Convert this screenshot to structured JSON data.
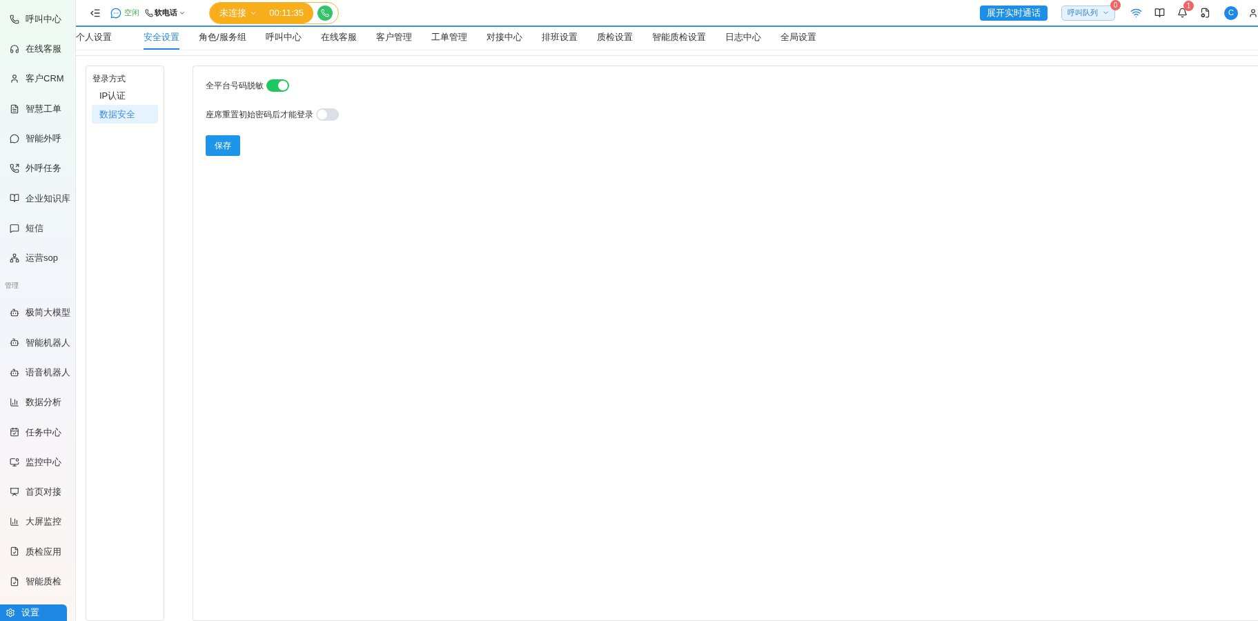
{
  "sidebar": {
    "items": [
      {
        "kind": "item",
        "label": "呼叫中心",
        "selected": false
      },
      {
        "kind": "item",
        "label": "在线客服",
        "selected": false
      },
      {
        "kind": "item",
        "label": "客户CRM",
        "selected": false
      },
      {
        "kind": "item",
        "label": "智慧工单",
        "selected": false
      },
      {
        "kind": "item",
        "label": "智能外呼",
        "selected": false
      },
      {
        "kind": "item",
        "label": "外呼任务",
        "selected": false
      },
      {
        "kind": "item",
        "label": "企业知识库",
        "selected": false
      },
      {
        "kind": "item",
        "label": "短信",
        "selected": false
      },
      {
        "kind": "item",
        "label": "运营sop",
        "selected": false
      },
      {
        "kind": "heading",
        "label": "管理"
      },
      {
        "kind": "item",
        "label": "极简大模型",
        "selected": false
      },
      {
        "kind": "item",
        "label": "智能机器人",
        "selected": false
      },
      {
        "kind": "item",
        "label": "语音机器人",
        "selected": false
      },
      {
        "kind": "item",
        "label": "数据分析",
        "selected": false
      },
      {
        "kind": "item",
        "label": "任务中心",
        "selected": false
      },
      {
        "kind": "item",
        "label": "监控中心",
        "selected": false
      },
      {
        "kind": "item",
        "label": "首页对接",
        "selected": false
      },
      {
        "kind": "item",
        "label": "大屏监控",
        "selected": false
      },
      {
        "kind": "item",
        "label": "质检应用",
        "selected": false
      },
      {
        "kind": "item",
        "label": "智能质检",
        "selected": false
      },
      {
        "kind": "item",
        "label": "设置",
        "selected": true
      }
    ]
  },
  "topbar": {
    "status": "空闲",
    "phone_mode": "软电话",
    "call": {
      "state": "未连接",
      "timer": "00:11:35"
    },
    "live_button": "展开实时通话",
    "queue": {
      "label": "呼叫队列",
      "badge": "0"
    },
    "notifications_badge": "1",
    "avatar": "C"
  },
  "tabs": [
    {
      "label": "个人设置",
      "selected": false
    },
    {
      "label": "安全设置",
      "selected": true
    },
    {
      "label": "角色/服务组",
      "selected": false
    },
    {
      "label": "呼叫中心",
      "selected": false
    },
    {
      "label": "在线客服",
      "selected": false
    },
    {
      "label": "客户管理",
      "selected": false
    },
    {
      "label": "工单管理",
      "selected": false
    },
    {
      "label": "对接中心",
      "selected": false
    },
    {
      "label": "排班设置",
      "selected": false
    },
    {
      "label": "质检设置",
      "selected": false
    },
    {
      "label": "智能质检设置",
      "selected": false
    },
    {
      "label": "日志中心",
      "selected": false
    },
    {
      "label": "全局设置",
      "selected": false
    }
  ],
  "subnav": {
    "title": "登录方式",
    "items": [
      {
        "label": "IP认证",
        "selected": false
      },
      {
        "label": "数据安全",
        "selected": true
      }
    ]
  },
  "settings": [
    {
      "label": "全平台号码脱敏",
      "on": true
    },
    {
      "label": "座席重置初始密码后才能登录",
      "on": false
    }
  ],
  "save_button": "保存"
}
